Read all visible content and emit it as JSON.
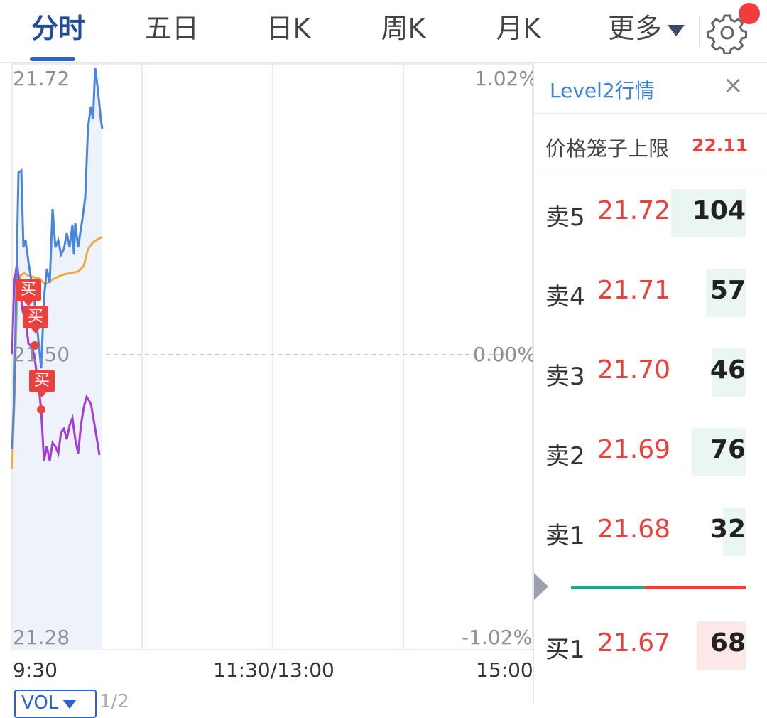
{
  "tabs": [
    {
      "label": "分时",
      "active": true
    },
    {
      "label": "五日",
      "active": false
    },
    {
      "label": "日K",
      "active": false
    },
    {
      "label": "周K",
      "active": false
    },
    {
      "label": "月K",
      "active": false
    }
  ],
  "more_label": "更多",
  "icons": {
    "settings": "gear-icon",
    "notification": "red-dot-badge",
    "more_dropdown": "triangle-down-icon",
    "close": "close-icon",
    "expand": "triangle-right-icon"
  },
  "colors": {
    "accent": "#2a63c6",
    "up": "#e8413e",
    "down": "#2aa38a",
    "price_line": "#4a86e0",
    "avg_line": "#f0a93a",
    "indicator_line": "#a23fd0"
  },
  "chart": {
    "y_top": "21.72",
    "y_mid": "21.50",
    "y_bottom": "21.28",
    "pct_top": "1.02%",
    "pct_mid": "0.00%",
    "pct_bottom": "-1.02%",
    "time_start": "9:30",
    "time_mid": "11:30/13:00",
    "time_end": "15:00",
    "buy_tag_label": "买",
    "vol_label": "VOL",
    "vol_page": "1/2"
  },
  "level2": {
    "title": "Level2行情",
    "close_symbol": "×",
    "cage_label": "价格笼子上限",
    "cage_value": "22.11",
    "asks": [
      {
        "label": "卖5",
        "price": "21.72",
        "volume": "104",
        "fill": 0.43
      },
      {
        "label": "卖4",
        "price": "21.71",
        "volume": "57",
        "fill": 0.23
      },
      {
        "label": "卖3",
        "price": "21.70",
        "volume": "46",
        "fill": 0.19
      },
      {
        "label": "卖2",
        "price": "21.69",
        "volume": "76",
        "fill": 0.31
      },
      {
        "label": "卖1",
        "price": "21.68",
        "volume": "32",
        "fill": 0.13
      }
    ],
    "bids": [
      {
        "label": "买1",
        "price": "21.67",
        "volume": "68",
        "fill": 0.28
      }
    ],
    "ratio_green": 0.42
  }
}
